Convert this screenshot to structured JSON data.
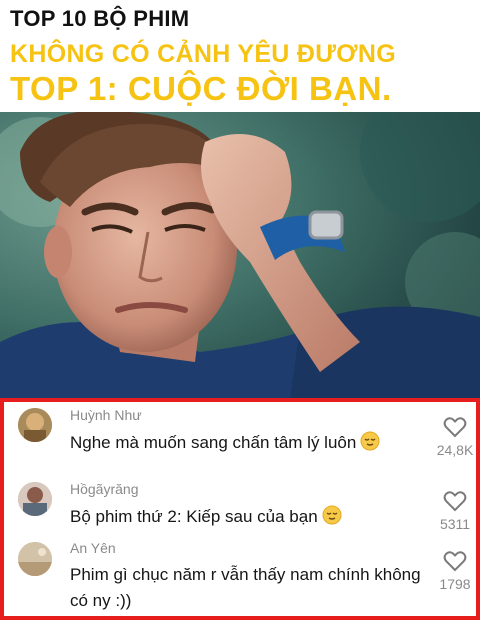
{
  "header": {
    "line1": "TOP 10 BỘ PHIM",
    "line2": "KHÔNG CÓ CẢNH YÊU ĐƯƠNG",
    "line3": "TOP 1: CUỘC ĐỜI BẠN."
  },
  "photo": {
    "icon": "crying-man-photo"
  },
  "colors": {
    "accent_yellow": "#f6c312",
    "highlight_border": "#e81d1d",
    "meta_gray": "#8a8a8a"
  },
  "comments": [
    {
      "username": "Huỳnh Như",
      "text": "Nghe mà muốn sang chấn tâm lý luôn",
      "emoji": "relieved-face-icon",
      "likes": "24,8K"
    },
    {
      "username": "Hồgãyrăng",
      "text": "Bộ phim thứ 2: Kiếp sau của bạn",
      "emoji": "relieved-face-icon",
      "likes": "5311"
    },
    {
      "username": "An Yên",
      "text_line1": "Phim gì chục năm r vẫn thấy nam chính không",
      "text_line2": "có ny :))",
      "likes": "1798"
    }
  ]
}
